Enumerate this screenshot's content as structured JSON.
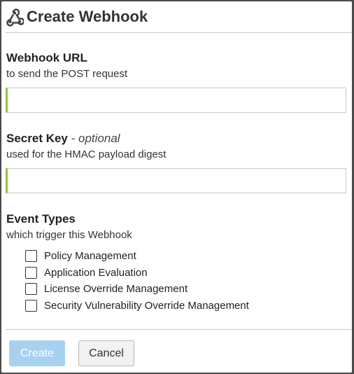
{
  "dialog": {
    "title": "Create Webhook",
    "title_icon": "webhook-icon"
  },
  "fields": {
    "url": {
      "label": "Webhook URL",
      "help": "to send the POST request",
      "value": "",
      "placeholder": ""
    },
    "secret": {
      "label": "Secret Key",
      "optional_label": "- optional",
      "help": "used for the HMAC payload digest",
      "value": "",
      "placeholder": ""
    }
  },
  "event_types": {
    "label": "Event Types",
    "help": "which trigger this Webhook",
    "options": [
      {
        "label": "Policy Management",
        "checked": false
      },
      {
        "label": "Application Evaluation",
        "checked": false
      },
      {
        "label": "License Override Management",
        "checked": false
      },
      {
        "label": "Security Vulnerability Override Management",
        "checked": false
      }
    ]
  },
  "actions": {
    "create_label": "Create",
    "cancel_label": "Cancel"
  },
  "colors": {
    "input_accent": "#8dc63f",
    "create_disabled_bg": "#a8d1f0"
  }
}
